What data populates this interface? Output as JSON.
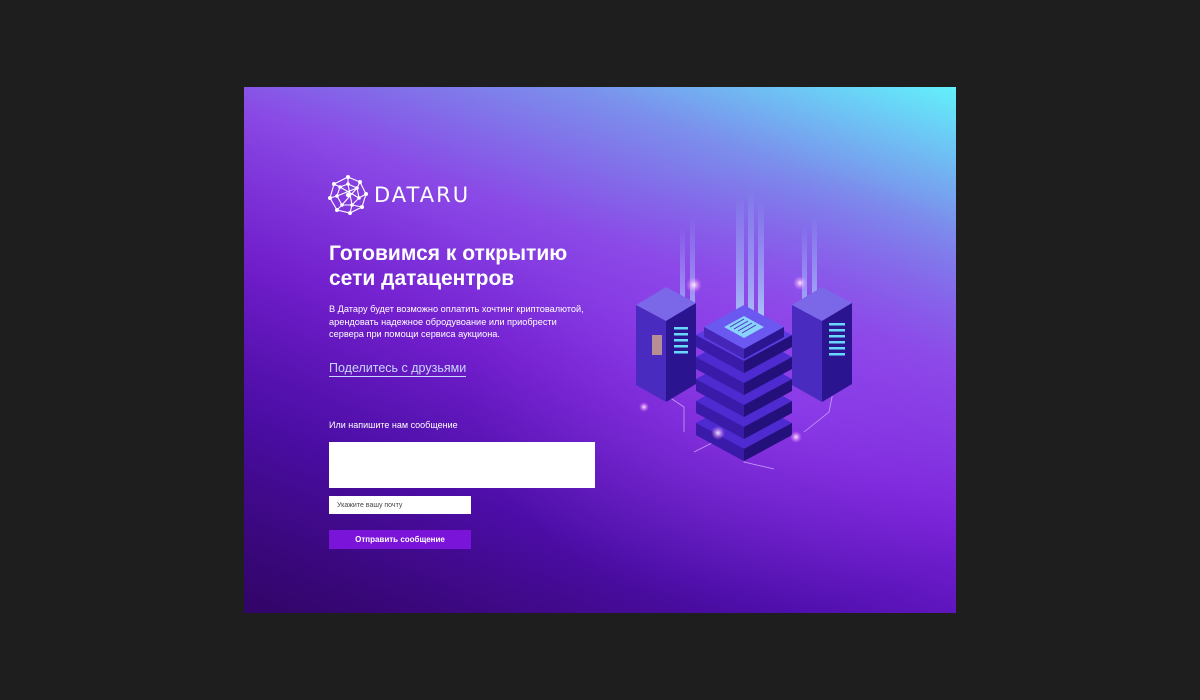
{
  "brand": {
    "name": "DATARU",
    "logo_icon": "network-globe-icon"
  },
  "hero": {
    "headline_line1": "Готовимся к открытию",
    "headline_line2": "сети датацентров",
    "description": "В Датару будет возможно оплатить хочтинг криптовалютой, арендовать надежное обродувоание или приобрести сервера при помощи сервиса аукциона.",
    "share_link": "Поделитесь с друзьями"
  },
  "form": {
    "label": "Или напишите нам сообщение",
    "message_value": "",
    "email_placeholder": "Укажите вашу почту",
    "submit_label": "Отправить сообщение"
  },
  "illustration": {
    "icon": "isometric-datacenter-servers-icon"
  },
  "colors": {
    "page_background": "#1e1e1e",
    "gradient_cyan": "#62f1fb",
    "gradient_violet": "#7a22d9",
    "gradient_deep": "#36076e",
    "button": "#7a14d9",
    "link": "#c9d6ff"
  }
}
